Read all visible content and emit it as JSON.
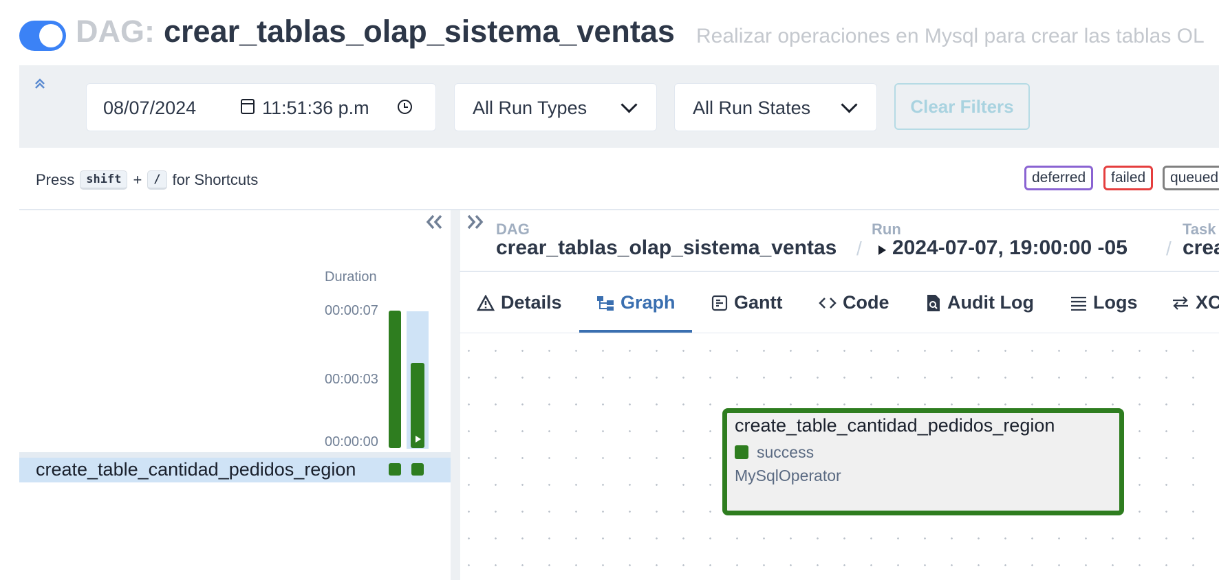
{
  "header": {
    "toggle_state": "on",
    "dag_prefix": "DAG:",
    "dag_name": "crear_tablas_olap_sistema_ventas",
    "description": "Realizar operaciones en Mysql para crear las tablas OL"
  },
  "filters": {
    "date": "08/07/2024",
    "time": "11:51:36 p.m",
    "run_type": "All Run Types",
    "run_state": "All Run States",
    "clear_label": "Clear Filters"
  },
  "shortcuts": {
    "press": "Press",
    "key1": "shift",
    "plus": "+",
    "key2": "/",
    "suffix": "for Shortcuts"
  },
  "legend": [
    {
      "label": "deferred",
      "color": "#8a63d2"
    },
    {
      "label": "failed",
      "color": "#e53e3e"
    },
    {
      "label": "queued",
      "color": "#808080"
    }
  ],
  "grid": {
    "duration_label": "Duration",
    "ticks": [
      "00:00:07",
      "00:00:03",
      "00:00:00"
    ],
    "runs": [
      {
        "duration_fraction": 1.0,
        "state": "success"
      },
      {
        "duration_fraction": 0.62,
        "state": "success",
        "selected": true
      }
    ],
    "tasks": [
      {
        "name": "create_table_cantidad_pedidos_region",
        "states": [
          "success",
          "success"
        ]
      }
    ]
  },
  "breadcrumb": {
    "dag_label": "DAG",
    "dag_value": "crear_tablas_olap_sistema_ventas",
    "run_label": "Run",
    "run_value": "2024-07-07, 19:00:00 -05",
    "task_label": "Task",
    "task_value": "create_table_cantidad_pedidos_region",
    "separator": "/"
  },
  "tabs": [
    {
      "label": "Details",
      "icon": "warning-triangle-icon"
    },
    {
      "label": "Graph",
      "icon": "graph-icon",
      "active": true
    },
    {
      "label": "Gantt",
      "icon": "gantt-icon"
    },
    {
      "label": "Code",
      "icon": "code-icon"
    },
    {
      "label": "Audit Log",
      "icon": "audit-file-icon"
    },
    {
      "label": "Logs",
      "icon": "lines-icon"
    },
    {
      "label": "XCom",
      "icon": "swap-arrows-icon"
    }
  ],
  "graph_node": {
    "task_id": "create_table_cantidad_pedidos_region",
    "state": "success",
    "operator": "MySqlOperator"
  },
  "colors": {
    "success": "#2e7d1f",
    "accent": "#3a6fb0",
    "toggle": "#3b82f6"
  }
}
